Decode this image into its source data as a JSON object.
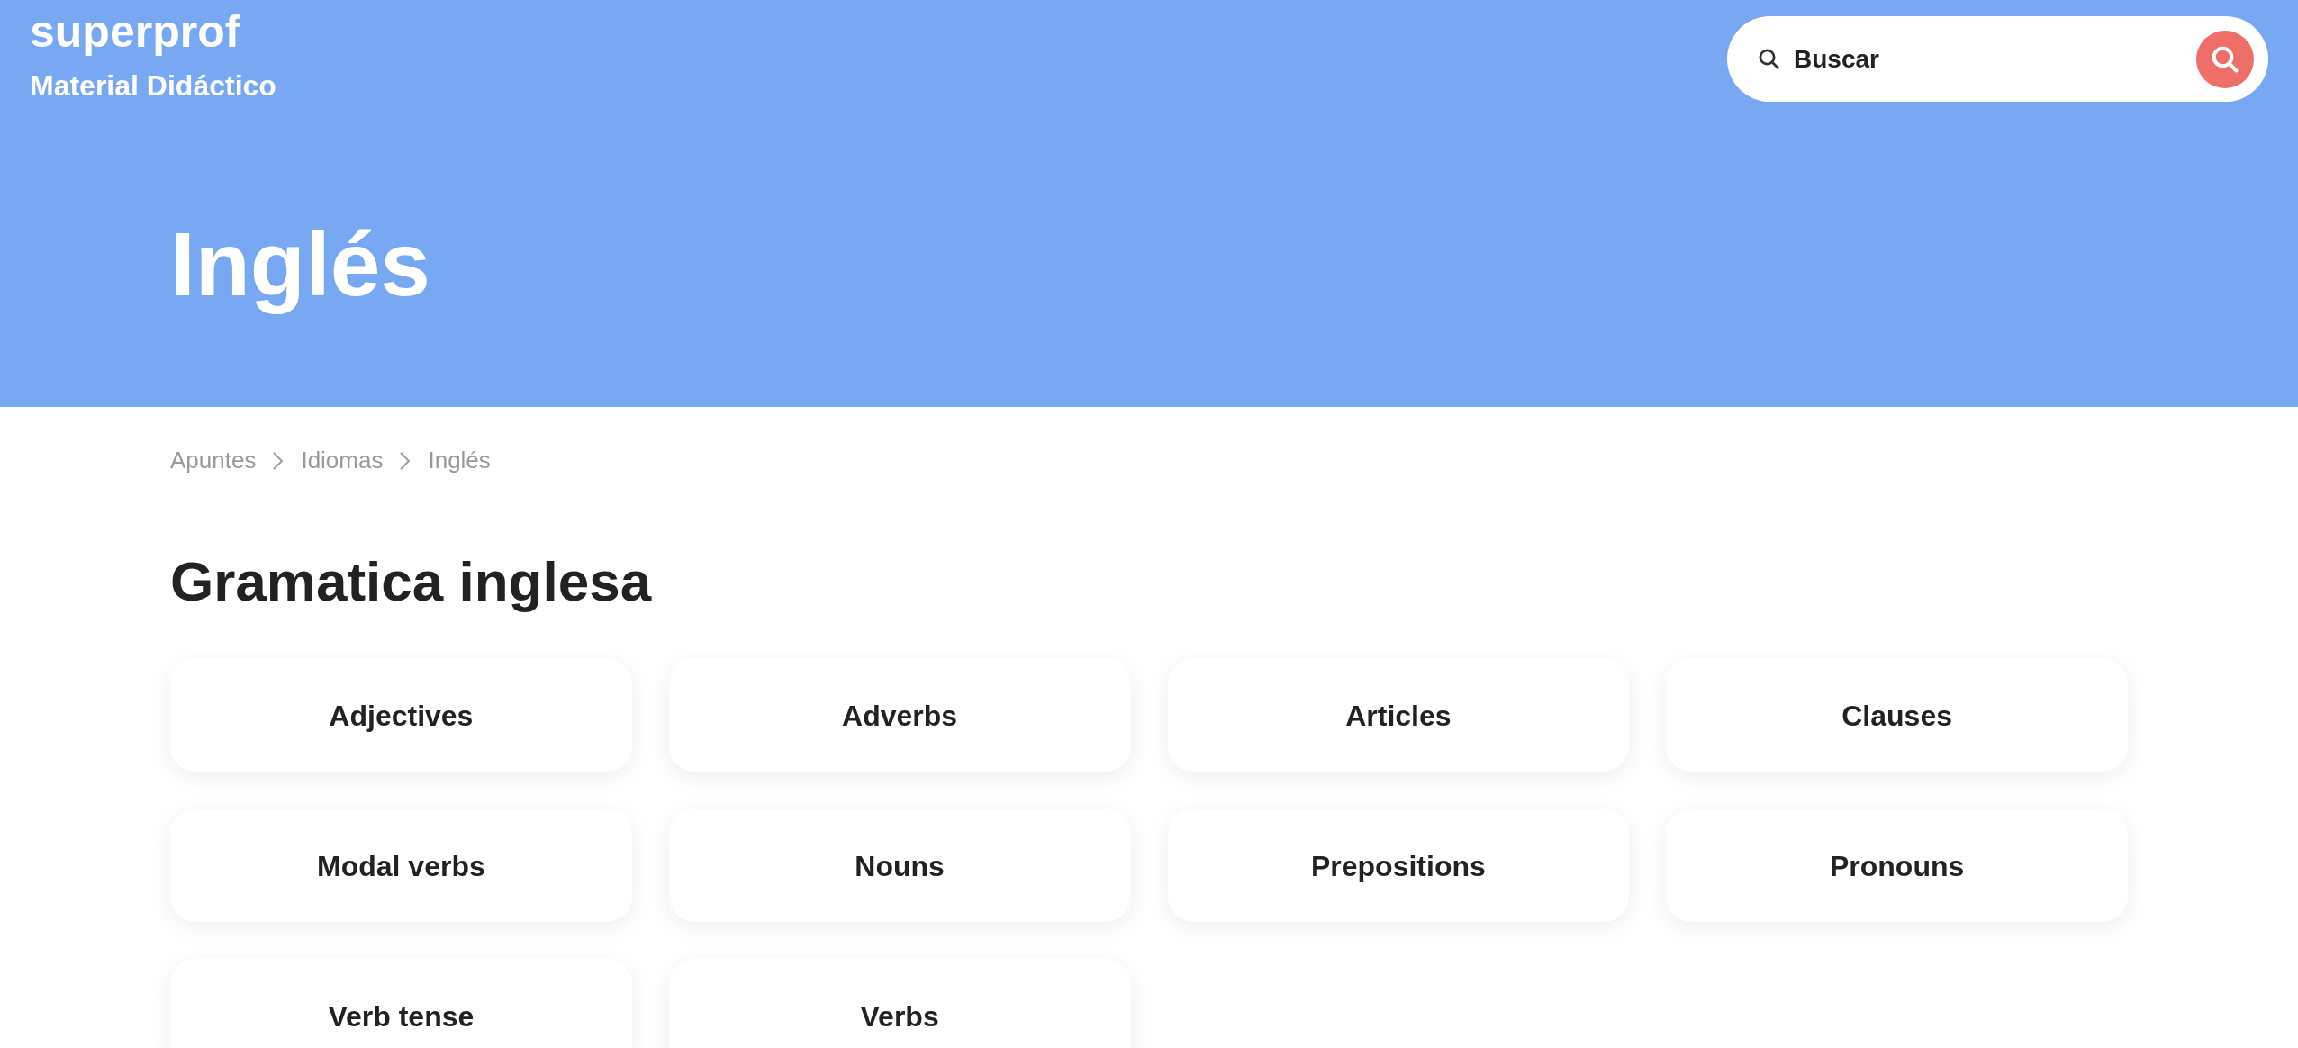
{
  "header": {
    "logo": "superprof",
    "subtitle": "Material Didáctico",
    "search": {
      "placeholder": "Buscar"
    }
  },
  "hero": {
    "title": "Inglés"
  },
  "breadcrumb": [
    {
      "label": "Apuntes"
    },
    {
      "label": "Idiomas"
    },
    {
      "label": "Inglés"
    }
  ],
  "section": {
    "title": "Gramatica inglesa",
    "topics": [
      {
        "label": "Adjectives"
      },
      {
        "label": "Adverbs"
      },
      {
        "label": "Articles"
      },
      {
        "label": "Clauses"
      },
      {
        "label": "Modal verbs"
      },
      {
        "label": "Nouns"
      },
      {
        "label": "Prepositions"
      },
      {
        "label": "Pronouns"
      },
      {
        "label": "Verb tense"
      },
      {
        "label": "Verbs"
      }
    ]
  }
}
